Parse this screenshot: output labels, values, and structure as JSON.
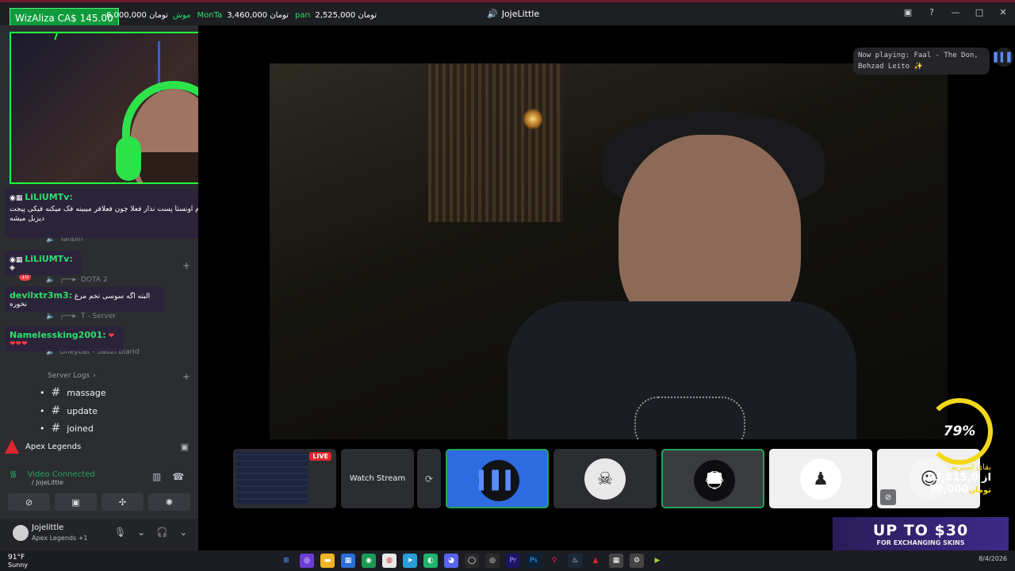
{
  "window": {
    "title": "JojeLittle"
  },
  "overlay_ticker": {
    "account": "WizAliza",
    "account_value": "CA$ 145.00",
    "items": [
      {
        "symbol": "موش",
        "value": "6,000,000 تومان"
      },
      {
        "symbol": "MonTa",
        "value": "3,460,000 تومان"
      },
      {
        "symbol": "parı",
        "value": "2,525,000 تومان"
      }
    ]
  },
  "sidebar": {
    "voice_channels": [
      {
        "label": "Tanbih"
      },
      {
        "label": "DOTA 2"
      },
      {
        "label": "T - Server"
      },
      {
        "label": "Gheybat - Sabzi Biarid"
      }
    ],
    "category": {
      "label": "Server Logs"
    },
    "text_channels": [
      {
        "label": "massage"
      },
      {
        "label": "update"
      },
      {
        "label": "joined"
      }
    ],
    "badge_count": "10"
  },
  "chat": [
    {
      "user": "LiLiUMTv:",
      "text": "ب نظرم اونستا پست نذار فعلا چون فعلافر میبینه فک میکنه فیکی پیجت دیزیل میشه"
    },
    {
      "user": "LiLiUMTv:",
      "text": ""
    },
    {
      "user": "devilxtr3m3:",
      "text": "البته اگه سوسی تخم مرغ نخوره"
    },
    {
      "user": "Namelessking2001:",
      "text": "❤❤❤❤"
    }
  ],
  "voice_panel": {
    "game": "Apex Legends",
    "status": "Video Connected",
    "channel": "/ JojeLittle"
  },
  "user": {
    "name": "Jojelittle",
    "status": "Apex Legends +1"
  },
  "now_playing": {
    "line1": "Now playing: Faal - The Don,",
    "line2": "Behzad Leito ✨"
  },
  "stream_tiles": {
    "live_label": "LIVE",
    "watch_label": "Watch Stream"
  },
  "goal": {
    "percent": "79%",
    "label": "بقای استریم",
    "current": "23,815,0",
    "of": "از",
    "target": "30,000",
    "currency": "تومان"
  },
  "promo": {
    "headline": "UP TO $30",
    "subline": "FOR EXCHANGING SKINS"
  },
  "taskbar": {
    "temp": "91°F",
    "condition": "Sunny",
    "date": "8/4/2026"
  },
  "colors": {
    "accent_green": "#25ff3c",
    "discord_green": "#23a55a",
    "brand_blue": "#2d6be0",
    "gauge_yellow": "#f3d81a"
  }
}
